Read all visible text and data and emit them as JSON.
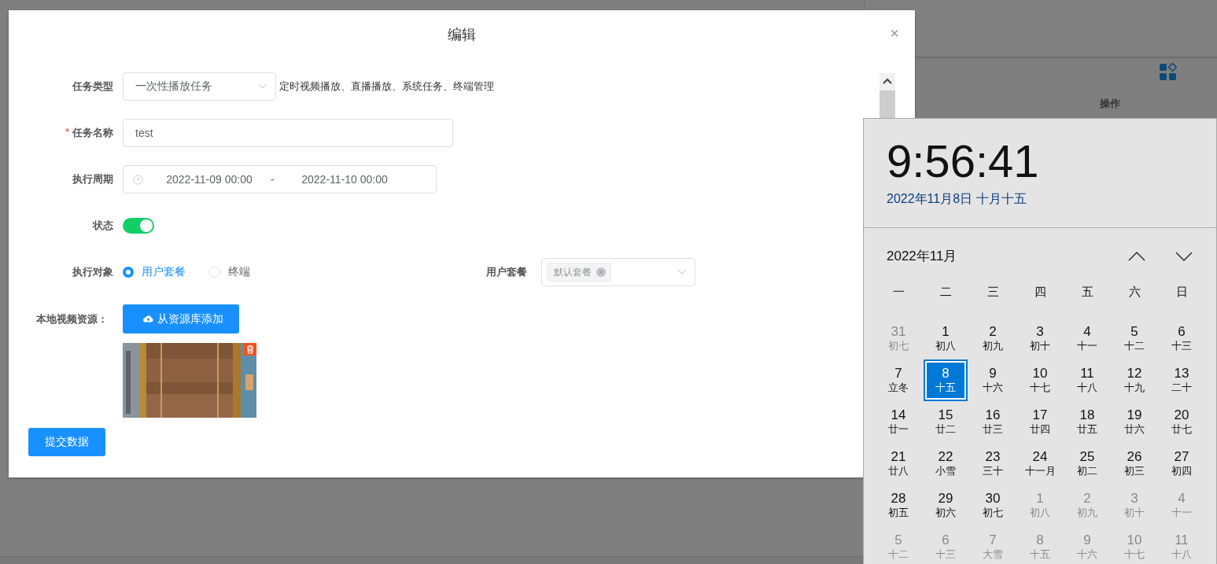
{
  "background": {
    "table_headers": [
      "操作"
    ]
  },
  "dialog": {
    "title": "编辑",
    "close": "×",
    "task_type": {
      "label": "任务类型",
      "value": "一次性播放任务",
      "hint": "定时视频播放、直播播放、系统任务、终端管理"
    },
    "task_name": {
      "label": "任务名称",
      "required_mark": "*",
      "value": "test"
    },
    "period": {
      "label": "执行周期",
      "start": "2022-11-09 00:00",
      "separator": "-",
      "end": "2022-11-10 00:00"
    },
    "status": {
      "label": "状态",
      "on": true
    },
    "target": {
      "label": "执行对象",
      "options": [
        {
          "label": "用户套餐",
          "selected": true
        },
        {
          "label": "终端",
          "selected": false
        }
      ]
    },
    "package": {
      "label": "用户套餐",
      "tags": [
        "默认套餐"
      ]
    },
    "video": {
      "label": "本地视频资源：",
      "add_button": "从资源库添加"
    },
    "submit": "提交数据"
  },
  "calendar": {
    "time": "9:56:41",
    "date": "2022年11月8日 十月十五",
    "month": "2022年11月",
    "weekdays": [
      "一",
      "二",
      "三",
      "四",
      "五",
      "六",
      "日"
    ],
    "days": [
      {
        "day": "31",
        "lunar": "初七",
        "in_month": false,
        "selected": false
      },
      {
        "day": "1",
        "lunar": "初八",
        "in_month": true,
        "selected": false
      },
      {
        "day": "2",
        "lunar": "初九",
        "in_month": true,
        "selected": false
      },
      {
        "day": "3",
        "lunar": "初十",
        "in_month": true,
        "selected": false
      },
      {
        "day": "4",
        "lunar": "十一",
        "in_month": true,
        "selected": false
      },
      {
        "day": "5",
        "lunar": "十二",
        "in_month": true,
        "selected": false
      },
      {
        "day": "6",
        "lunar": "十三",
        "in_month": true,
        "selected": false
      },
      {
        "day": "7",
        "lunar": "立冬",
        "in_month": true,
        "selected": false
      },
      {
        "day": "8",
        "lunar": "十五",
        "in_month": true,
        "selected": true
      },
      {
        "day": "9",
        "lunar": "十六",
        "in_month": true,
        "selected": false
      },
      {
        "day": "10",
        "lunar": "十七",
        "in_month": true,
        "selected": false
      },
      {
        "day": "11",
        "lunar": "十八",
        "in_month": true,
        "selected": false
      },
      {
        "day": "12",
        "lunar": "十九",
        "in_month": true,
        "selected": false
      },
      {
        "day": "13",
        "lunar": "二十",
        "in_month": true,
        "selected": false
      },
      {
        "day": "14",
        "lunar": "廿一",
        "in_month": true,
        "selected": false
      },
      {
        "day": "15",
        "lunar": "廿二",
        "in_month": true,
        "selected": false
      },
      {
        "day": "16",
        "lunar": "廿三",
        "in_month": true,
        "selected": false
      },
      {
        "day": "17",
        "lunar": "廿四",
        "in_month": true,
        "selected": false
      },
      {
        "day": "18",
        "lunar": "廿五",
        "in_month": true,
        "selected": false
      },
      {
        "day": "19",
        "lunar": "廿六",
        "in_month": true,
        "selected": false
      },
      {
        "day": "20",
        "lunar": "廿七",
        "in_month": true,
        "selected": false
      },
      {
        "day": "21",
        "lunar": "廿八",
        "in_month": true,
        "selected": false
      },
      {
        "day": "22",
        "lunar": "小雪",
        "in_month": true,
        "selected": false
      },
      {
        "day": "23",
        "lunar": "三十",
        "in_month": true,
        "selected": false
      },
      {
        "day": "24",
        "lunar": "十一月",
        "in_month": true,
        "selected": false
      },
      {
        "day": "25",
        "lunar": "初二",
        "in_month": true,
        "selected": false
      },
      {
        "day": "26",
        "lunar": "初三",
        "in_month": true,
        "selected": false
      },
      {
        "day": "27",
        "lunar": "初四",
        "in_month": true,
        "selected": false
      },
      {
        "day": "28",
        "lunar": "初五",
        "in_month": true,
        "selected": false
      },
      {
        "day": "29",
        "lunar": "初六",
        "in_month": true,
        "selected": false
      },
      {
        "day": "30",
        "lunar": "初七",
        "in_month": true,
        "selected": false
      },
      {
        "day": "1",
        "lunar": "初八",
        "in_month": false,
        "selected": false
      },
      {
        "day": "2",
        "lunar": "初九",
        "in_month": false,
        "selected": false
      },
      {
        "day": "3",
        "lunar": "初十",
        "in_month": false,
        "selected": false
      },
      {
        "day": "4",
        "lunar": "十一",
        "in_month": false,
        "selected": false
      },
      {
        "day": "5",
        "lunar": "十二",
        "in_month": false,
        "selected": false
      },
      {
        "day": "6",
        "lunar": "十三",
        "in_month": false,
        "selected": false
      },
      {
        "day": "7",
        "lunar": "大雪",
        "in_month": false,
        "selected": false
      },
      {
        "day": "8",
        "lunar": "十五",
        "in_month": false,
        "selected": false
      },
      {
        "day": "9",
        "lunar": "十六",
        "in_month": false,
        "selected": false
      },
      {
        "day": "10",
        "lunar": "十七",
        "in_month": false,
        "selected": false
      },
      {
        "day": "11",
        "lunar": "十八",
        "in_month": false,
        "selected": false
      }
    ]
  }
}
